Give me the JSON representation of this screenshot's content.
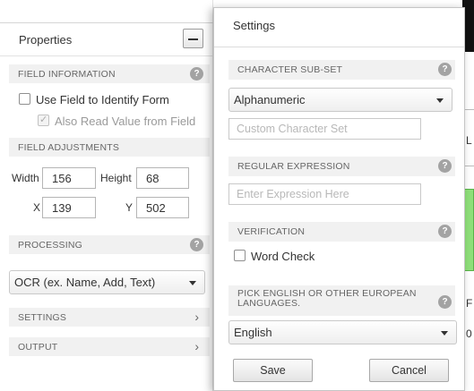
{
  "properties": {
    "title": "Properties",
    "field_information": {
      "header": "FIELD INFORMATION",
      "use_field_label": "Use Field to Identify Form",
      "use_field_checked": false,
      "read_value_label": "Also Read Value from Field",
      "read_value_checked": true
    },
    "field_adjustments": {
      "header": "FIELD ADJUSTMENTS",
      "width_label": "Width",
      "width_value": "156",
      "height_label": "Height",
      "height_value": "68",
      "x_label": "X",
      "x_value": "139",
      "y_label": "Y",
      "y_value": "502"
    },
    "processing": {
      "header": "PROCESSING",
      "selected": "OCR (ex. Name, Add, Text)"
    },
    "settings_header": "SETTINGS",
    "output_header": "OUTPUT",
    "help_glyph": "?",
    "chevron_glyph": "›"
  },
  "settings_modal": {
    "title": "Settings",
    "character_subset": {
      "header": "CHARACTER SUB-SET",
      "selected": "Alphanumeric",
      "custom_placeholder": "Custom Character Set"
    },
    "regular_expression": {
      "header": "REGULAR EXPRESSION",
      "placeholder": "Enter Expression Here"
    },
    "verification": {
      "header": "VERIFICATION",
      "word_check_label": "Word Check",
      "word_check_checked": false
    },
    "language": {
      "header": "PICK ENGLISH OR OTHER EUROPEAN LANGUAGES.",
      "selected": "English"
    },
    "save_label": "Save",
    "cancel_label": "Cancel"
  },
  "background_fragments": {
    "frag1": "L",
    "frag2": "F",
    "frag3": "0"
  },
  "colors": {
    "section_bg": "#f1f1f1",
    "help_icon": "#a3a3a3",
    "highlight_green": "#8fe07a"
  }
}
